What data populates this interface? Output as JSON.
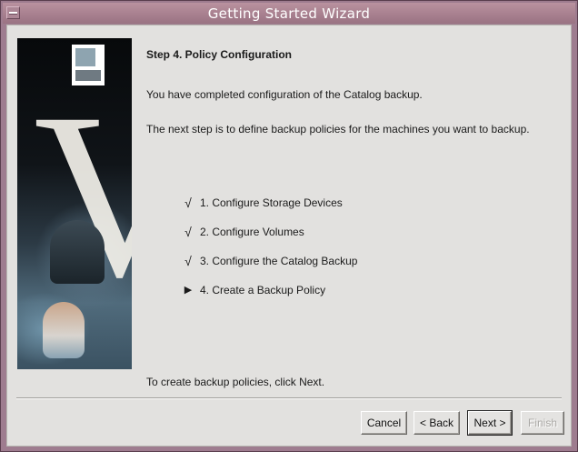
{
  "window": {
    "title": "Getting Started Wizard"
  },
  "wizard": {
    "heading": "Step 4. Policy Configuration",
    "intro": "You have completed configuration of the Catalog backup.",
    "next_step": "The next step is to define backup policies for the machines you want to backup.",
    "steps": [
      {
        "mark": "√",
        "label": "1.  Configure Storage Devices",
        "state": "done"
      },
      {
        "mark": "√",
        "label": "2.  Configure Volumes",
        "state": "done"
      },
      {
        "mark": "√",
        "label": "3.  Configure the Catalog Backup",
        "state": "done"
      },
      {
        "mark": "▶",
        "label": "4.  Create a Backup Policy",
        "state": "current"
      }
    ],
    "footer_text": "To create backup policies, click Next."
  },
  "buttons": {
    "cancel": "Cancel",
    "back": "< Back",
    "next": "Next >",
    "finish": "Finish"
  },
  "colors": {
    "titlebar": "#a8808f",
    "client_bg": "#e2e1df"
  }
}
